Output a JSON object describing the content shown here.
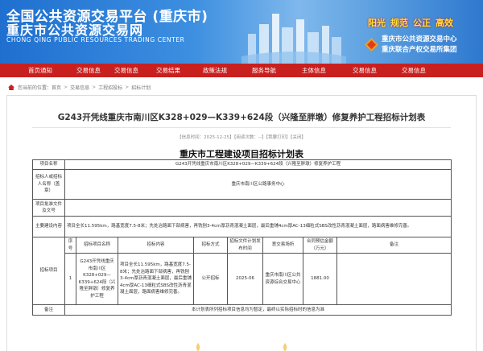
{
  "header": {
    "title_line1": "全国公共资源交易平台 (重庆市)",
    "title_line2": "重庆市公共资源交易网",
    "title_en": "CHONG QING PUBLIC RESOURCES TRADING CENTER",
    "slogans": [
      "阳光",
      "规范",
      "公正",
      "高效"
    ],
    "org_line1": "重庆市公共资源交易中心",
    "org_line2": "重庆联合产权交易所集团"
  },
  "nav": {
    "items": [
      "首页通知",
      "交易信息",
      "交易信息",
      "交易结果",
      "政策法规",
      "服务导航",
      "主体信息",
      "交易信息",
      "交易信息"
    ]
  },
  "breadcrumb": {
    "prefix": "您当前的位置：",
    "items": [
      "首页",
      "交易信息",
      "工程招投标",
      "招标计划"
    ]
  },
  "article": {
    "title": "G243开凭线重庆市南川区K328+029—K339+624段（兴隆至胖墩）修复养护工程招标计划表",
    "meta": "【信息时间：2025-12-25】【阅读次数：--】【我要打印】【关闭】"
  },
  "doc": {
    "title": "重庆市工程建设项目招标计划表",
    "rows": {
      "project_name_label": "项目名称",
      "project_name_value": "G243开凭线重庆市南川区K328+029—K339+624段（兴隆至胖墩）修复养护工程",
      "tenderer_label": "招标人或招标人名称（盖章）",
      "tenderer_value": "重庆市南川区公路事务中心",
      "approval_label": "项目批准文件及文号",
      "approval_value": "",
      "content_label": "主要建设内容",
      "content_value": "项目全长11.595km，路基宽度7.5-8米；先处治路面下部病害，再铣刨3-4cm厚沥青混凝土面层，最后重铺4cm厚AC-13细粒式SBS改性沥青混凝土面层，路面病害维修完善。",
      "plan_label": "招标项目",
      "plan_headers": [
        "序号",
        "招标项目名称",
        "招标内容",
        "招标方式",
        "招标文件计划发布时间",
        "意交易场所",
        "合同预估金额（万元）",
        "备注"
      ],
      "plan_row": [
        "1",
        "G243开凭线重庆市南川区K328+029—K339+624段（兴隆至胖墩）修复养护工程",
        "项目全长11.595km，路基宽度7.5-8米；先处治路面下部病害，再铣刨3-4cm厚沥青混凝土面层，最后重铺4cm厚AC-13细粒式SBS改性沥青混凝土面层，路面病害维修完善。",
        "公开招标",
        "2025-06",
        "重庆市南川区公共资源综合交易中心",
        "1881.00",
        ""
      ],
      "remark_label": "备注",
      "remark_value": "本计划表所列招标项目信息均为暂定，最终以实际招标时的信息为准"
    }
  },
  "colors": {
    "nav": "#c8201f",
    "banner": "#2e78cf",
    "slogan": "#ffe03b"
  }
}
